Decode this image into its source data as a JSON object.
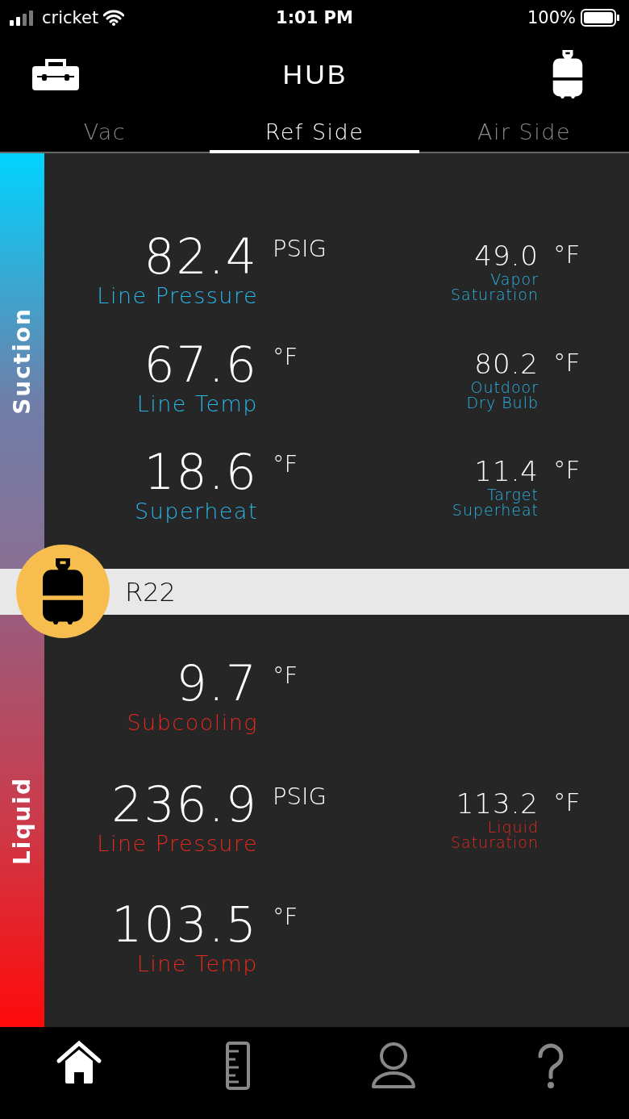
{
  "status_bar": {
    "carrier": "cricket",
    "time": "1:01 PM",
    "battery": "100%"
  },
  "header": {
    "title": "HUB"
  },
  "tabs": [
    {
      "label": "Vac",
      "selected": false
    },
    {
      "label": "Ref Side",
      "selected": true
    },
    {
      "label": "Air Side",
      "selected": false
    }
  ],
  "sections": [
    {
      "kind": "suction",
      "label": "Suction",
      "color": "#29b6e8",
      "rows": [
        {
          "value": "82.4",
          "unit": "PSIG",
          "label": "Line Pressure",
          "aux": {
            "value": "49.0",
            "unit": "°F",
            "label": "Vapor\nSaturation"
          }
        },
        {
          "value": "67.6",
          "unit": "°F",
          "label": "Line Temp",
          "aux": {
            "value": "80.2",
            "unit": "°F",
            "label": "Outdoor\nDry Bulb"
          }
        },
        {
          "value": "18.6",
          "unit": "°F",
          "label": "Superheat",
          "aux": {
            "value": "11.4",
            "unit": "°F",
            "label": "Target\nSuperheat"
          }
        }
      ]
    },
    {
      "kind": "refrigerant",
      "name": "R22"
    },
    {
      "kind": "liquid",
      "label": "Liquid",
      "color": "#e8281e",
      "rows": [
        {
          "value": "9.7",
          "unit": "°F",
          "label": "Subcooling"
        },
        {
          "value": "236.9",
          "unit": "PSIG",
          "label": "Line Pressure",
          "aux": {
            "value": "113.2",
            "unit": "°F",
            "label": "Liquid\nSaturation"
          }
        },
        {
          "value": "103.5",
          "unit": "°F",
          "label": "Line Temp"
        }
      ]
    }
  ],
  "nav": [
    {
      "kind": "home",
      "selected": true
    },
    {
      "kind": "ruler",
      "selected": false
    },
    {
      "kind": "person",
      "selected": false
    },
    {
      "kind": "help",
      "selected": false
    }
  ]
}
